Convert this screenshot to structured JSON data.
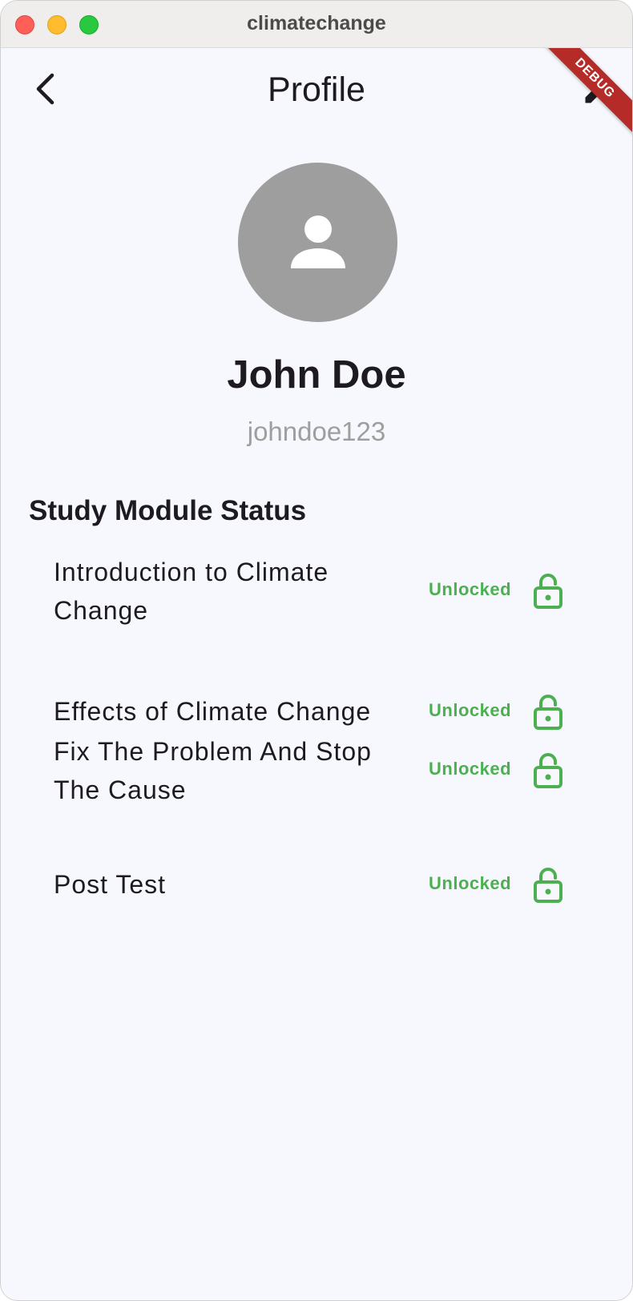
{
  "window": {
    "title": "climatechange"
  },
  "header": {
    "title": "Profile",
    "debug_label": "DEBUG"
  },
  "profile": {
    "name": "John Doe",
    "username": "johndoe123"
  },
  "modules": {
    "section_title": "Study Module Status",
    "items": [
      {
        "title": "Introduction to Climate Change",
        "status": "Unlocked"
      },
      {
        "title": "Effects of Climate Change",
        "status": "Unlocked"
      },
      {
        "title": "Fix The Problem And Stop The Cause",
        "status": "Unlocked"
      },
      {
        "title": "Post Test",
        "status": "Unlocked"
      }
    ]
  },
  "colors": {
    "status_unlocked": "#4caf50",
    "avatar_bg": "#9e9e9e",
    "background": "#f7f8fd",
    "debug_banner": "#b42b28"
  },
  "icons": {
    "back": "arrow-back-icon",
    "edit": "pencil-icon",
    "avatar": "person-icon",
    "status": "lock-open-icon"
  }
}
